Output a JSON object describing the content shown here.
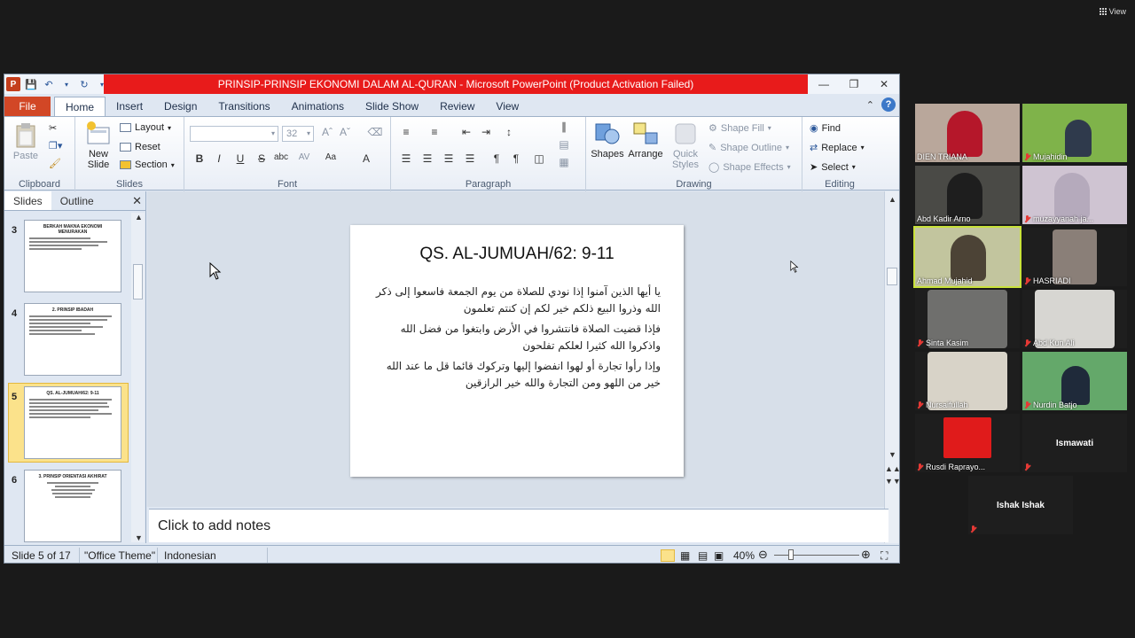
{
  "app": {
    "title": "PRINSIP-PRINSIP EKONOMI DALAM AL-QURAN  -  Microsoft PowerPoint (Product Activation Failed)"
  },
  "meeting": {
    "view_label": "View"
  },
  "tabs": [
    {
      "label": "File"
    },
    {
      "label": "Home"
    },
    {
      "label": "Insert"
    },
    {
      "label": "Design"
    },
    {
      "label": "Transitions"
    },
    {
      "label": "Animations"
    },
    {
      "label": "Slide Show"
    },
    {
      "label": "Review"
    },
    {
      "label": "View"
    }
  ],
  "ribbon": {
    "clipboard": {
      "label": "Clipboard",
      "paste": "Paste"
    },
    "slides": {
      "label": "Slides",
      "new_slide": "New",
      "new_slide2": "Slide",
      "layout": "Layout",
      "reset": "Reset",
      "section": "Section"
    },
    "font": {
      "label": "Font",
      "size": "32"
    },
    "paragraph": {
      "label": "Paragraph"
    },
    "drawing": {
      "label": "Drawing",
      "shapes": "Shapes",
      "arrange": "Arrange",
      "quick": "Quick",
      "styles": "Styles",
      "shape_fill": "Shape Fill",
      "shape_outline": "Shape Outline",
      "shape_effects": "Shape Effects"
    },
    "editing": {
      "label": "Editing",
      "find": "Find",
      "replace": "Replace",
      "select": "Select"
    }
  },
  "slides_pane": {
    "tab_slides": "Slides",
    "tab_outline": "Outline",
    "thumbs": [
      {
        "num": "3",
        "title": "BERKAH MAKNA EKONOMI MENURAKAN"
      },
      {
        "num": "4",
        "title": "2. PRINSIP IBADAH"
      },
      {
        "num": "5",
        "title": "QS. AL-JUMUAH/62: 9-11"
      },
      {
        "num": "6",
        "title": "3. PRINSIP ORIENTASI AKHIRAT"
      }
    ]
  },
  "slide": {
    "title": "QS. AL-JUMUAH/62: 9-11",
    "verses": [
      "يا أيها الذين آمنوا إذا نودي للصلاة من يوم الجمعة فاسعوا إلى ذكر الله وذروا البيع ذلكم خير لكم إن كنتم تعلمون",
      "فإذا قضيت الصلاة فانتشروا في الأرض وابتغوا من فضل الله واذكروا الله كثيرا لعلكم تفلحون",
      "وإذا رأوا تجارة أو لهوا انفضوا إليها وتركوك قائما قل ما عند الله خير من اللهو ومن التجارة والله خير الرازقين"
    ]
  },
  "notes": {
    "placeholder": "Click to add notes"
  },
  "status": {
    "slide_info": "Slide 5 of 17",
    "theme": "\"Office Theme\"",
    "language": "Indonesian",
    "zoom": "40%"
  },
  "participants": [
    {
      "name": "DIEN TRIANA",
      "muted": false,
      "bg": "#b9a79b",
      "fg": "#b5172a"
    },
    {
      "name": "Mujahidin",
      "muted": true,
      "bg": "#7fb34a",
      "fg": "#2f3a4c"
    },
    {
      "name": "Abd Kadir Arno",
      "muted": false,
      "bg": "#4a4a46",
      "fg": "#1e1e1e"
    },
    {
      "name": "muzayyanah ja...",
      "muted": true,
      "bg": "#cfc4d2",
      "fg": "#9b8fa5"
    },
    {
      "name": "Ahmad Mujahid",
      "muted": false,
      "bg": "#c2c59e",
      "fg": "#4c4336"
    },
    {
      "name": "HASRIADI",
      "muted": true,
      "bg": "#8a7f78",
      "fg": "#cc9a86"
    },
    {
      "name": "Sinta Kasim",
      "muted": true,
      "bg": "#6f6f6d",
      "fg": "#8a8886"
    },
    {
      "name": "Abd Kun Ali",
      "muted": true,
      "bg": "#d7d6d2",
      "fg": "#6a5040"
    },
    {
      "name": "Nursaifullah",
      "muted": true,
      "bg": "#d8d3c8",
      "fg": "#9a7a66"
    },
    {
      "name": "Nurdin Batjo",
      "muted": true,
      "bg": "#64a86a",
      "fg": "#1f2a3a"
    },
    {
      "name": "Rusdi Raprayo...",
      "muted": true,
      "bg": "#e01b1b",
      "fg": "#f2f2f2"
    },
    {
      "name": "Ismawati",
      "muted": true,
      "bg": "#1e1e1e",
      "fg": ""
    },
    {
      "name": "Ishak Ishak",
      "muted": true,
      "bg": "#1e1e1e",
      "fg": ""
    }
  ]
}
